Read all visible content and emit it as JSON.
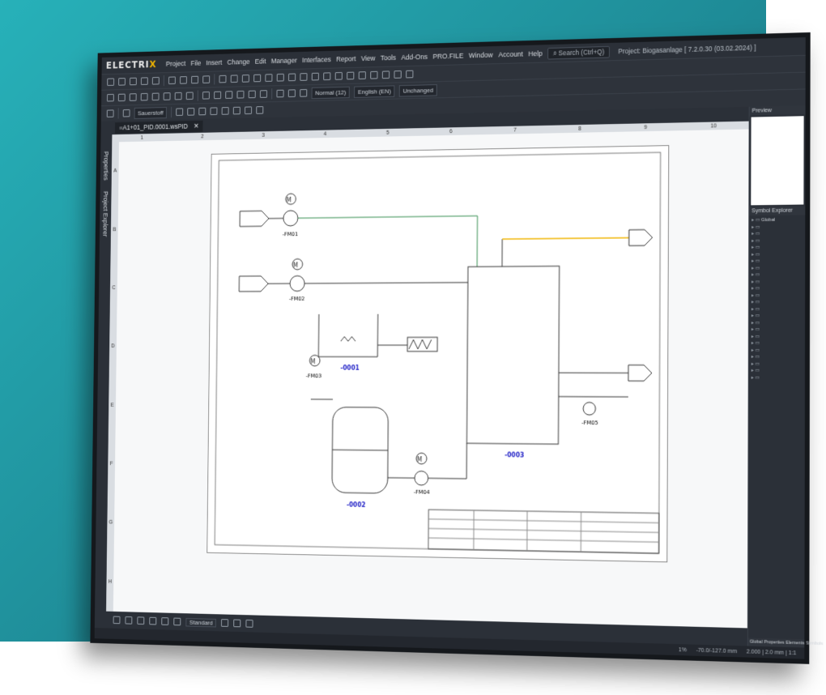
{
  "app": {
    "logo": "ELECTRIX",
    "menu": [
      "Project",
      "File",
      "Insert",
      "Change",
      "Edit",
      "Manager",
      "Interfaces",
      "Report",
      "View",
      "Tools",
      "Add-Ons",
      "PRO.FILE",
      "Window",
      "Account",
      "Help"
    ],
    "search_label": "Search (Ctrl+Q)",
    "project_title": "Project: Biogasanlage [ 7.2.0.30 (03.02.2024) ]"
  },
  "toolbar": {
    "medium_select": "Sauerstoff",
    "format_select": "Normal (12)",
    "language_select": "English (EN)",
    "layer_select": "Unchanged"
  },
  "side_tabs": [
    "Properties",
    "Project Explorer"
  ],
  "document": {
    "tab_label": "=A1+01_PID.0001.wsPID",
    "ruler_columns": [
      "1",
      "2",
      "3",
      "4",
      "5",
      "6",
      "7",
      "8",
      "9",
      "10"
    ],
    "ruler_rows": [
      "A",
      "B",
      "C",
      "D",
      "E",
      "F",
      "G",
      "H"
    ]
  },
  "diagram": {
    "tanks": [
      "-0001",
      "-0002",
      "-0003"
    ],
    "pumps": [
      "-FM01",
      "-FM02",
      "-FM03",
      "-FM04",
      "-FM05"
    ],
    "colors": {
      "green_line": "#2f8a4a",
      "yellow_line": "#f0b400",
      "blue_label": "#2727c8",
      "line": "#333333"
    }
  },
  "bottom_bar": {
    "standard_select": "Standard"
  },
  "right_panel": {
    "preview_header": "Preview",
    "explorer_header": "Symbol Explorer",
    "tree_root": "Global",
    "tabs": [
      "Global",
      "Properties",
      "Elements",
      "Symbols",
      "Macros"
    ]
  },
  "status": {
    "zoom": "1%",
    "coords": "-70.0/-127.0 mm",
    "grid": "2.000 | 2.0 mm | 1:1"
  }
}
